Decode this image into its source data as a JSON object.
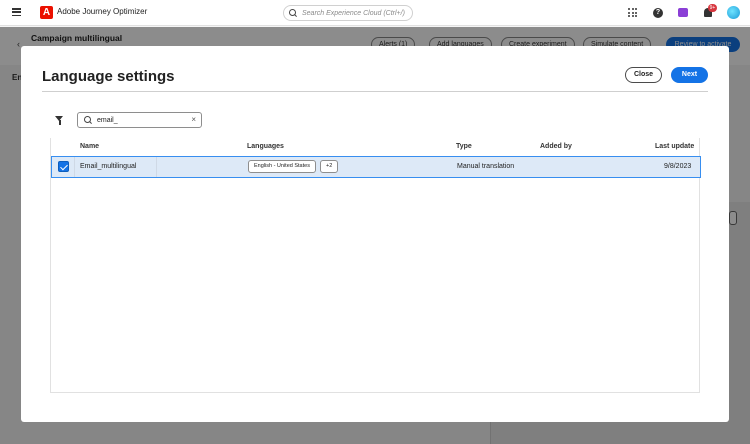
{
  "shell": {
    "logo_letter": "A",
    "app_name": "Adobe Journey Optimizer",
    "search_placeholder": "Search Experience Cloud (Ctrl+/)",
    "notifications_count": "9+"
  },
  "campaign": {
    "title": "Campaign multilingual",
    "tab_label": "En",
    "alerts_label": "Alerts (1)",
    "add_languages_label": "Add languages",
    "create_experiment_label": "Create experiment",
    "simulate_content_label": "Simulate content",
    "review_label": "Review to activate"
  },
  "dialog": {
    "title": "Language settings",
    "close_label": "Close",
    "next_label": "Next",
    "search_value": "email_",
    "clear_symbol": "×",
    "columns": {
      "name": "Name",
      "languages": "Languages",
      "type": "Type",
      "added_by": "Added by",
      "last_update": "Last update"
    },
    "rows": [
      {
        "name": "Email_multilingual",
        "language_tag": "English - United States",
        "extra_languages": "+2",
        "type": "Manual translation",
        "added_by": "",
        "last_update": "9/8/2023",
        "selected": true
      }
    ]
  },
  "colors": {
    "accent": "#1473e6",
    "selected_row": "#dde9f7",
    "adobe_red": "#eb1000"
  }
}
